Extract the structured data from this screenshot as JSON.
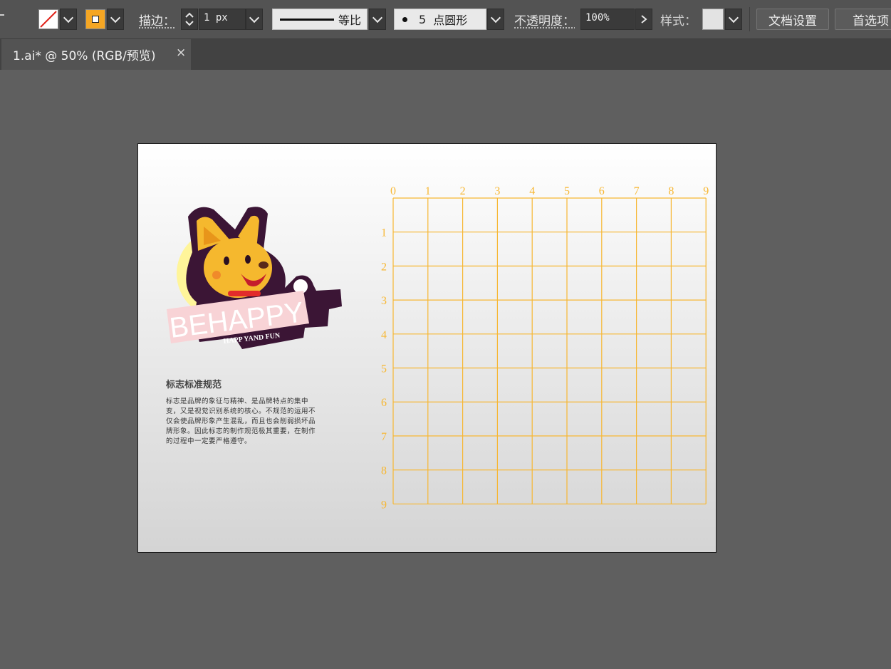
{
  "control_bar": {
    "stroke_label": "描边：",
    "stroke_weight": "1 px",
    "profile_label": "等比",
    "brush_size": "5",
    "brush_label": "点圆形",
    "opacity_label": "不透明度：",
    "opacity_value": "100%",
    "style_label": "样式：",
    "doc_setup_button": "文档设置",
    "preferences_button": "首选项"
  },
  "tab": {
    "title": "1.ai* @ 50% (RGB/预览)",
    "close": "×"
  },
  "artboard": {
    "logo_text": "BEHAPPY",
    "logo_subtext": "HAPP YAND FUN",
    "heading": "标志标准规范",
    "body": "标志是品牌的象征与精神、是品牌特点的集中变，又是视觉识别系统的核心。不规范的运用不仅会使品牌形象产生混乱，而且也会削弱损坏品牌形象。因此标志的制作规范极其重要，在制作的过程中一定要严格遵守。"
  },
  "grid": {
    "x_labels": [
      "0",
      "1",
      "2",
      "3",
      "4",
      "5",
      "6",
      "7",
      "8",
      "9"
    ],
    "y_labels": [
      "1",
      "2",
      "3",
      "4",
      "5",
      "6",
      "7",
      "8",
      "9"
    ],
    "line_color": "#f7b733"
  },
  "colors": {
    "fill_swatch": "#f5a623",
    "logo_dark": "#3b1535",
    "logo_yellow": "#f5b82e",
    "logo_pink": "#f8d3d6"
  }
}
